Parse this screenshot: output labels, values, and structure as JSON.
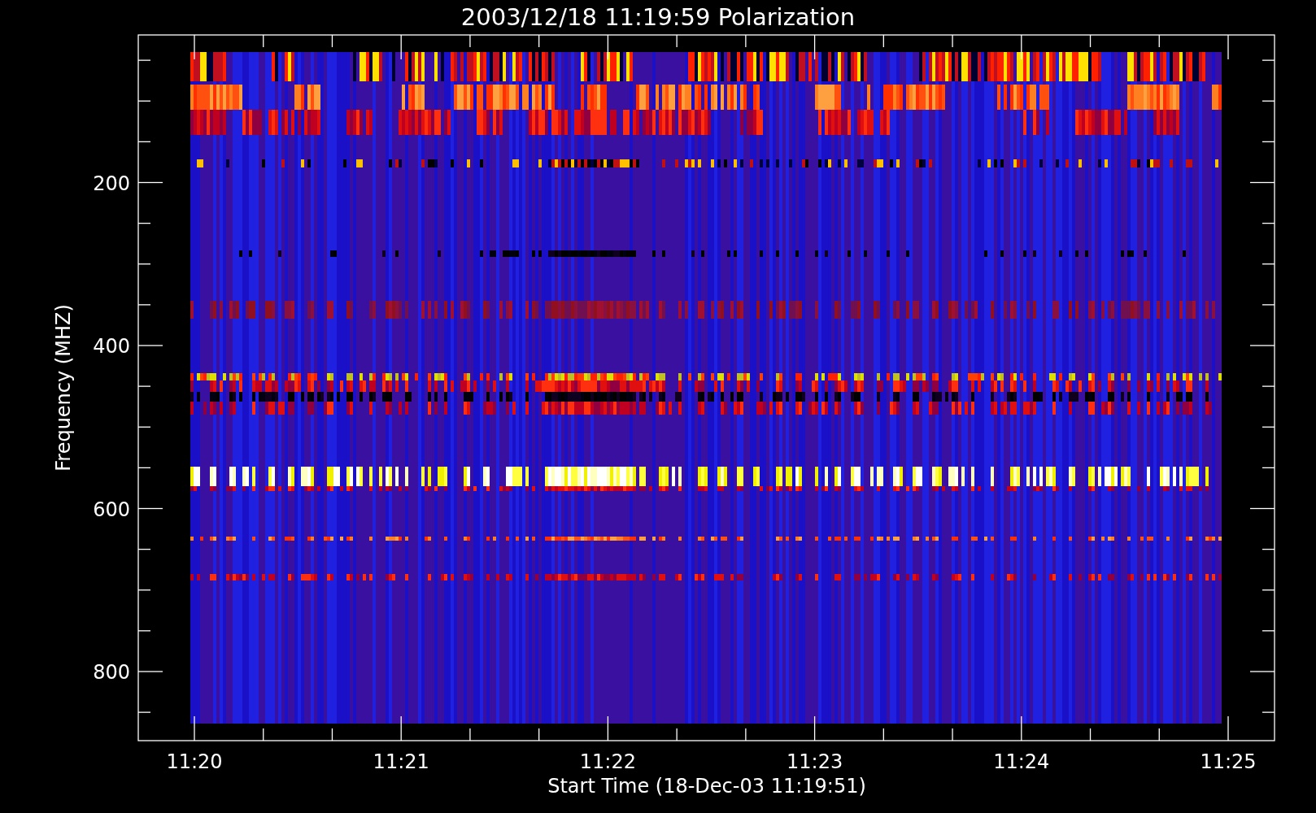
{
  "title": "2003/12/18 11:19:59 Polarization",
  "y_axis": {
    "label": "Frequency (MHZ)",
    "ticks": [
      "200",
      "400",
      "600",
      "800"
    ]
  },
  "x_axis": {
    "label": "Start Time (18-Dec-03 11:19:51)",
    "ticks": [
      "11:20",
      "11:21",
      "11:22",
      "11:23",
      "11:24",
      "11:25"
    ]
  }
}
